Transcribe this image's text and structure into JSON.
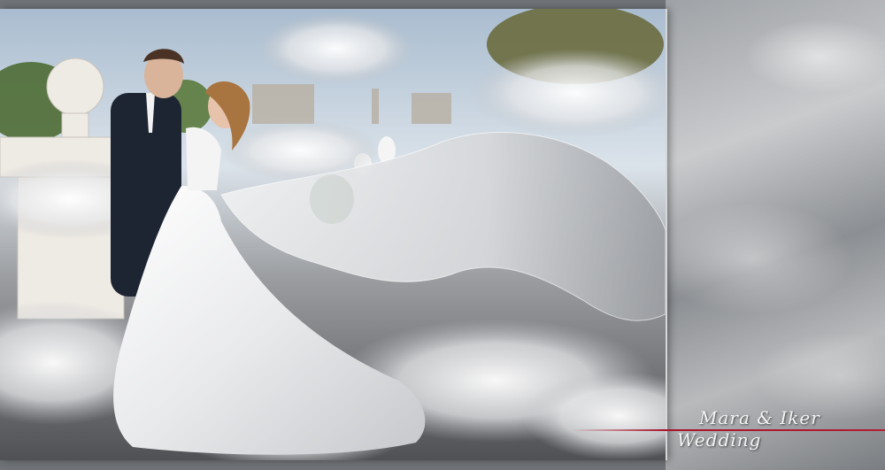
{
  "caption": {
    "names": "Mara & Iker",
    "subtitle": "Wedding"
  },
  "colors": {
    "accent_line": "#a8142c",
    "panel_gray": "#9fa2a6",
    "caption_text": "#f4f4f4"
  }
}
